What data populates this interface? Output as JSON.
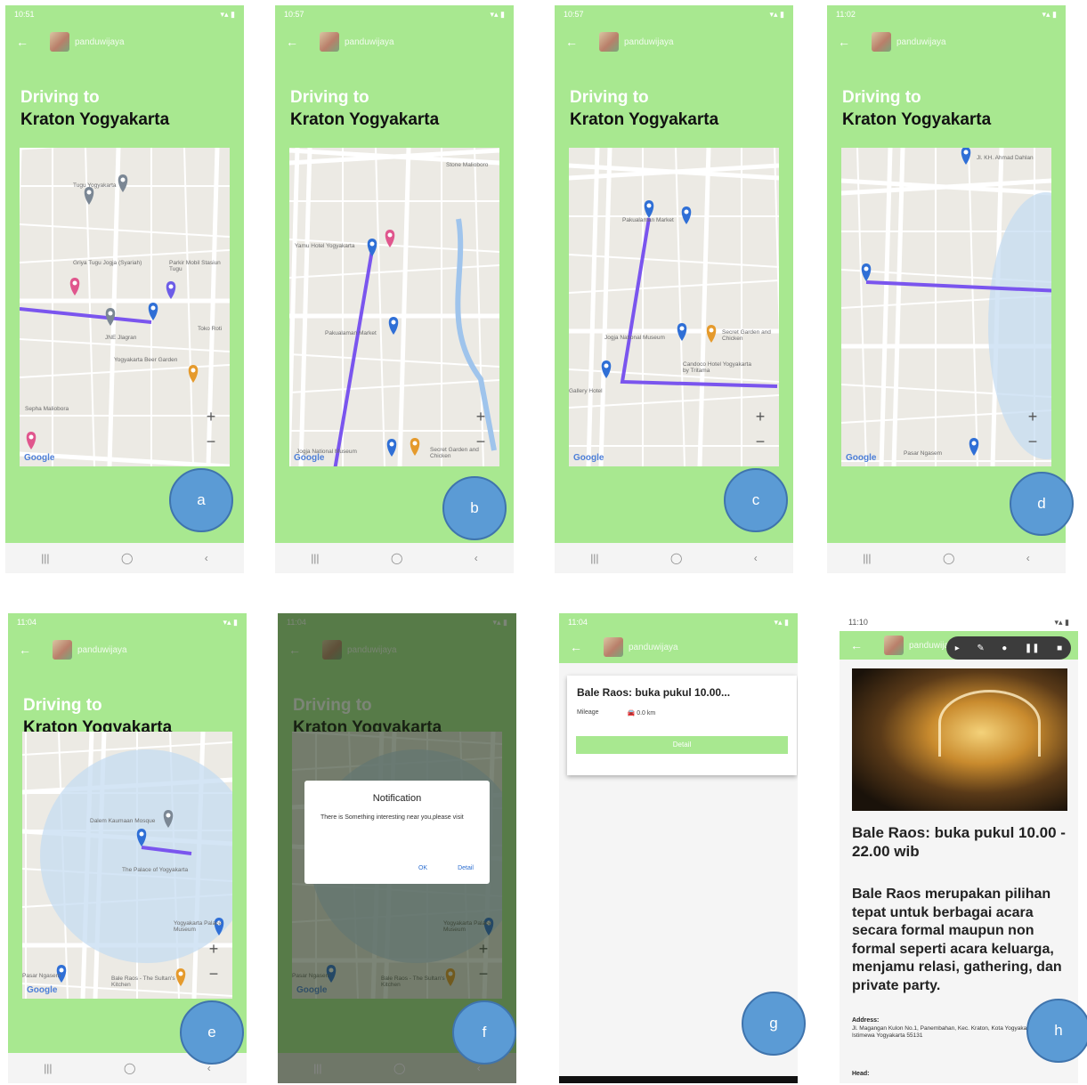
{
  "app": {
    "name": "panduwijaya",
    "driving_label": "Driving to",
    "destination": "Kraton Yogyakarta",
    "map_brand": "Google"
  },
  "panels": [
    {
      "label": "a",
      "time": "10:51"
    },
    {
      "label": "b",
      "time": "10:57"
    },
    {
      "label": "c",
      "time": "10:57"
    },
    {
      "label": "d",
      "time": "11:02"
    },
    {
      "label": "e",
      "time": "11:04"
    },
    {
      "label": "f",
      "time": "11:04"
    },
    {
      "label": "g",
      "time": "11:04"
    },
    {
      "label": "h",
      "time": "11:10"
    }
  ],
  "map_places": {
    "a": [
      "Tugu Yogyakarta",
      "Griya Tugu Jogja (Syariah)",
      "Parkir Mobil Stasiun Tugu",
      "JNE Jlagran",
      "Toko Roti",
      "Yogyakarta Beer Garden",
      "Sepha Maliobora"
    ],
    "b": [
      "Yamu Hotel Yogyakarta",
      "Pakualaman Market",
      "Jogja National Museum",
      "Secret Garden and Chicken",
      "Stone Malioboro"
    ],
    "c": [
      "Pakualaman Market",
      "Jogja National Museum",
      "Secret Garden and Chicken",
      "Candoco Hotel Yogyakarta by Tritama",
      "Gallery Hotel"
    ],
    "d": [
      "Pasar Ngasem",
      "Jl. KH. Ahmad Dahlan"
    ],
    "e": [
      "Dalem Kaumaan Mosque",
      "The Palace of Yogyakarta",
      "Yogyakarta Palace Museum",
      "Pasar Ngasem",
      "Bale Raos - The Sultan's Kitchen"
    ]
  },
  "notification": {
    "title": "Notification",
    "message": "There is Something interesting near you,please visit",
    "ok": "OK",
    "detail": "Detail"
  },
  "card": {
    "title": "Bale Raos: buka pukul 10.00...",
    "mileage_label": "Mileage",
    "distance": "0.0 km",
    "button": "Detail"
  },
  "detail": {
    "title": "Bale Raos: buka pukul 10.00 - 22.00 wib",
    "description": "Bale Raos merupakan pilihan tepat untuk berbagai acara secara formal maupun non formal seperti acara keluarga, menjamu relasi, gathering, dan private party.",
    "address_label": "Address:",
    "address": "Jl. Magangan Kulon No.1, Panembahan, Kec. Kraton, Kota Yogyakarta, Daerah Istimewa Yogyakarta 55131",
    "head_label": "Head:"
  },
  "colors": {
    "app_green": "#a8e890",
    "route": "#7a55ee",
    "marker": "#2f6fd6",
    "label_circle": "#5b9bd5"
  },
  "icons": {
    "back": "arrow-left-icon",
    "nav": [
      "recents-icon",
      "home-icon",
      "back-chevron-icon"
    ]
  }
}
